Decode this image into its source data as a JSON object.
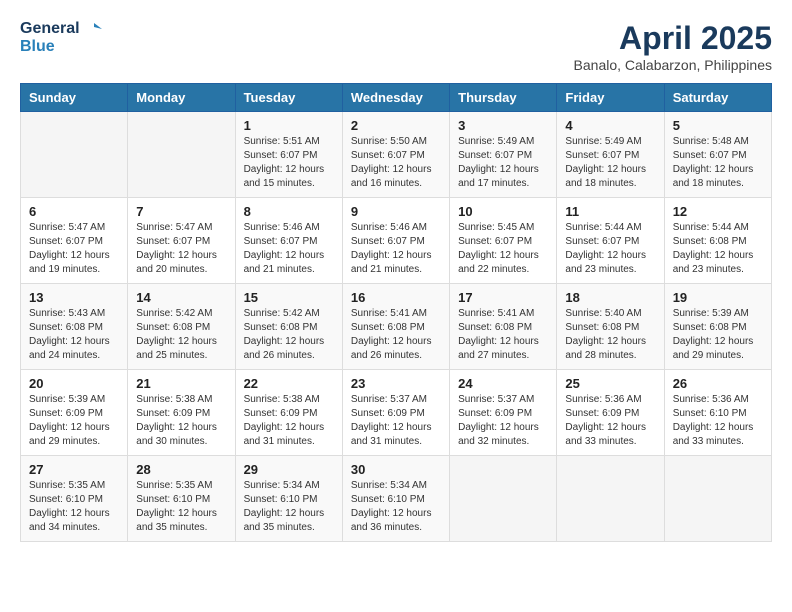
{
  "logo": {
    "line1": "General",
    "line2": "Blue"
  },
  "title": "April 2025",
  "location": "Banalo, Calabarzon, Philippines",
  "headers": [
    "Sunday",
    "Monday",
    "Tuesday",
    "Wednesday",
    "Thursday",
    "Friday",
    "Saturday"
  ],
  "weeks": [
    [
      {
        "day": "",
        "info": ""
      },
      {
        "day": "",
        "info": ""
      },
      {
        "day": "1",
        "info": "Sunrise: 5:51 AM\nSunset: 6:07 PM\nDaylight: 12 hours\nand 15 minutes."
      },
      {
        "day": "2",
        "info": "Sunrise: 5:50 AM\nSunset: 6:07 PM\nDaylight: 12 hours\nand 16 minutes."
      },
      {
        "day": "3",
        "info": "Sunrise: 5:49 AM\nSunset: 6:07 PM\nDaylight: 12 hours\nand 17 minutes."
      },
      {
        "day": "4",
        "info": "Sunrise: 5:49 AM\nSunset: 6:07 PM\nDaylight: 12 hours\nand 18 minutes."
      },
      {
        "day": "5",
        "info": "Sunrise: 5:48 AM\nSunset: 6:07 PM\nDaylight: 12 hours\nand 18 minutes."
      }
    ],
    [
      {
        "day": "6",
        "info": "Sunrise: 5:47 AM\nSunset: 6:07 PM\nDaylight: 12 hours\nand 19 minutes."
      },
      {
        "day": "7",
        "info": "Sunrise: 5:47 AM\nSunset: 6:07 PM\nDaylight: 12 hours\nand 20 minutes."
      },
      {
        "day": "8",
        "info": "Sunrise: 5:46 AM\nSunset: 6:07 PM\nDaylight: 12 hours\nand 21 minutes."
      },
      {
        "day": "9",
        "info": "Sunrise: 5:46 AM\nSunset: 6:07 PM\nDaylight: 12 hours\nand 21 minutes."
      },
      {
        "day": "10",
        "info": "Sunrise: 5:45 AM\nSunset: 6:07 PM\nDaylight: 12 hours\nand 22 minutes."
      },
      {
        "day": "11",
        "info": "Sunrise: 5:44 AM\nSunset: 6:07 PM\nDaylight: 12 hours\nand 23 minutes."
      },
      {
        "day": "12",
        "info": "Sunrise: 5:44 AM\nSunset: 6:08 PM\nDaylight: 12 hours\nand 23 minutes."
      }
    ],
    [
      {
        "day": "13",
        "info": "Sunrise: 5:43 AM\nSunset: 6:08 PM\nDaylight: 12 hours\nand 24 minutes."
      },
      {
        "day": "14",
        "info": "Sunrise: 5:42 AM\nSunset: 6:08 PM\nDaylight: 12 hours\nand 25 minutes."
      },
      {
        "day": "15",
        "info": "Sunrise: 5:42 AM\nSunset: 6:08 PM\nDaylight: 12 hours\nand 26 minutes."
      },
      {
        "day": "16",
        "info": "Sunrise: 5:41 AM\nSunset: 6:08 PM\nDaylight: 12 hours\nand 26 minutes."
      },
      {
        "day": "17",
        "info": "Sunrise: 5:41 AM\nSunset: 6:08 PM\nDaylight: 12 hours\nand 27 minutes."
      },
      {
        "day": "18",
        "info": "Sunrise: 5:40 AM\nSunset: 6:08 PM\nDaylight: 12 hours\nand 28 minutes."
      },
      {
        "day": "19",
        "info": "Sunrise: 5:39 AM\nSunset: 6:08 PM\nDaylight: 12 hours\nand 29 minutes."
      }
    ],
    [
      {
        "day": "20",
        "info": "Sunrise: 5:39 AM\nSunset: 6:09 PM\nDaylight: 12 hours\nand 29 minutes."
      },
      {
        "day": "21",
        "info": "Sunrise: 5:38 AM\nSunset: 6:09 PM\nDaylight: 12 hours\nand 30 minutes."
      },
      {
        "day": "22",
        "info": "Sunrise: 5:38 AM\nSunset: 6:09 PM\nDaylight: 12 hours\nand 31 minutes."
      },
      {
        "day": "23",
        "info": "Sunrise: 5:37 AM\nSunset: 6:09 PM\nDaylight: 12 hours\nand 31 minutes."
      },
      {
        "day": "24",
        "info": "Sunrise: 5:37 AM\nSunset: 6:09 PM\nDaylight: 12 hours\nand 32 minutes."
      },
      {
        "day": "25",
        "info": "Sunrise: 5:36 AM\nSunset: 6:09 PM\nDaylight: 12 hours\nand 33 minutes."
      },
      {
        "day": "26",
        "info": "Sunrise: 5:36 AM\nSunset: 6:10 PM\nDaylight: 12 hours\nand 33 minutes."
      }
    ],
    [
      {
        "day": "27",
        "info": "Sunrise: 5:35 AM\nSunset: 6:10 PM\nDaylight: 12 hours\nand 34 minutes."
      },
      {
        "day": "28",
        "info": "Sunrise: 5:35 AM\nSunset: 6:10 PM\nDaylight: 12 hours\nand 35 minutes."
      },
      {
        "day": "29",
        "info": "Sunrise: 5:34 AM\nSunset: 6:10 PM\nDaylight: 12 hours\nand 35 minutes."
      },
      {
        "day": "30",
        "info": "Sunrise: 5:34 AM\nSunset: 6:10 PM\nDaylight: 12 hours\nand 36 minutes."
      },
      {
        "day": "",
        "info": ""
      },
      {
        "day": "",
        "info": ""
      },
      {
        "day": "",
        "info": ""
      }
    ]
  ]
}
